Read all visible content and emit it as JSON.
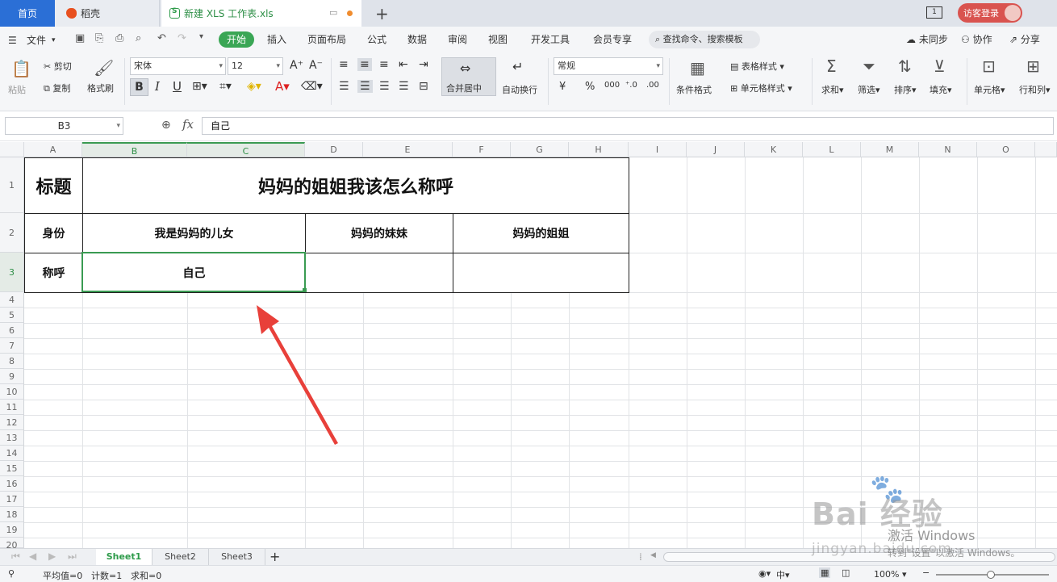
{
  "titlebar": {
    "tabs": [
      "首页",
      "稻壳",
      "新建 XLS 工作表.xls"
    ],
    "login": "访客登录",
    "window_count": "1"
  },
  "menu": {
    "file": "文件",
    "tabs": [
      "开始",
      "插入",
      "页面布局",
      "公式",
      "数据",
      "审阅",
      "视图",
      "开发工具",
      "会员专享"
    ],
    "search": "查找命令、搜索模板",
    "right": [
      "未同步",
      "协作",
      "分享"
    ]
  },
  "ribbon": {
    "paste": "粘贴",
    "cut": "剪切",
    "copy": "复制",
    "format_painter": "格式刷",
    "font_name": "宋体",
    "font_size": "12",
    "bold": "B",
    "italic": "I",
    "underline": "U",
    "merge": "合并居中",
    "wrap": "自动换行",
    "number_format": "常规",
    "conditional": "条件格式",
    "table_style": "表格样式",
    "cell_style": "单元格样式",
    "sum": "求和",
    "filter": "筛选",
    "sort": "排序",
    "fill": "填充",
    "cell": "单元格",
    "rowcol": "行和列",
    "percent": "%",
    "yen": "¥",
    "thousands": "000"
  },
  "formula_bar": {
    "name_box": "B3",
    "fx": "fx",
    "value": "自己"
  },
  "columns": [
    "A",
    "B",
    "C",
    "D",
    "E",
    "F",
    "G",
    "H",
    "I",
    "J",
    "K",
    "L",
    "M",
    "N",
    "O"
  ],
  "rows": [
    "1",
    "2",
    "3",
    "4",
    "5",
    "6",
    "7",
    "8",
    "9",
    "10",
    "11",
    "12",
    "13",
    "14",
    "15",
    "16",
    "17",
    "18",
    "19",
    "20"
  ],
  "table": {
    "r1_label": "标题",
    "title": "妈妈的姐姐我该怎么称呼",
    "r2_label": "身份",
    "h1": "我是妈妈的儿女",
    "h2": "妈妈的妹妹",
    "h3": "妈妈的姐姐",
    "r3_label": "称呼",
    "v1": "自己",
    "v2": "",
    "v3": ""
  },
  "sheets": [
    "Sheet1",
    "Sheet2",
    "Sheet3"
  ],
  "status": {
    "avg": "平均值=0",
    "count": "计数=1",
    "sum": "求和=0",
    "zoom": "100%"
  },
  "watermark": {
    "brand": "Bai 经验",
    "url": "jingyan.baidu.com",
    "activate": "激活 Windows",
    "activate_hint": "转到\"设置\"以激活 Windows。"
  },
  "colors": {
    "accent_green": "#3aa655",
    "home_blue": "#2b6fd6",
    "login_red": "#d9534f",
    "arrow_red": "#e8403a"
  }
}
